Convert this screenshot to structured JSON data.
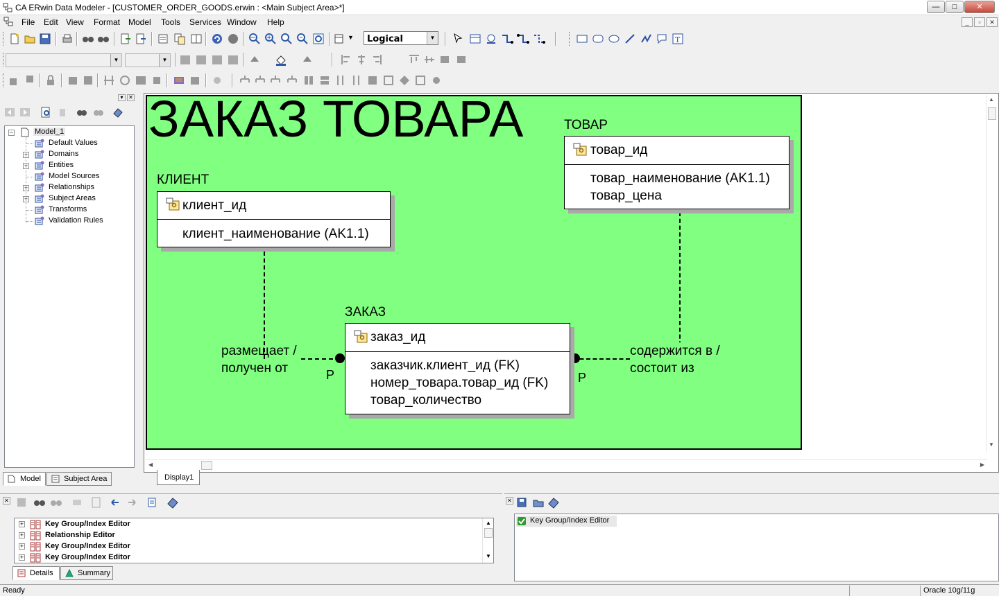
{
  "window": {
    "title": "CA ERwin Data Modeler - [CUSTOMER_ORDER_GOODS.erwin : <Main Subject Area>*]",
    "min_label": "—",
    "max_label": "□",
    "close_label": "✕"
  },
  "menu": {
    "items": [
      "File",
      "Edit",
      "View",
      "Format",
      "Model",
      "Tools",
      "Services",
      "Window",
      "Help"
    ]
  },
  "toolbar": {
    "model_view_value": "Logical"
  },
  "explorer": {
    "root": "Model_1",
    "items": [
      {
        "label": "Default Values",
        "expandable": false,
        "icon": "default-values-icon"
      },
      {
        "label": "Domains",
        "expandable": true,
        "icon": "domains-icon"
      },
      {
        "label": "Entities",
        "expandable": true,
        "icon": "entities-icon"
      },
      {
        "label": "Model Sources",
        "expandable": false,
        "icon": "model-sources-icon"
      },
      {
        "label": "Relationships",
        "expandable": true,
        "icon": "relationships-icon"
      },
      {
        "label": "Subject Areas",
        "expandable": true,
        "icon": "subject-areas-icon"
      },
      {
        "label": "Transforms",
        "expandable": false,
        "icon": "transforms-icon"
      },
      {
        "label": "Validation Rules",
        "expandable": false,
        "icon": "validation-rules-icon"
      }
    ],
    "tabs": [
      "Model",
      "Subject Area"
    ]
  },
  "diagram": {
    "title": "ЗАКАЗ ТОВАРА",
    "subject_area_color": "#80ff80",
    "entities": {
      "client": {
        "name": "КЛИЕНТ",
        "key": "клиент_ид",
        "attributes": [
          "клиент_наименование (AK1.1)"
        ]
      },
      "goods": {
        "name": "ТОВАР",
        "key": "товар_ид",
        "attributes": [
          "товар_наименование (AK1.1)",
          "товар_цена"
        ]
      },
      "order": {
        "name": "ЗАКАЗ",
        "key": "заказ_ид",
        "attributes": [
          "заказчик.клиент_ид (FK)",
          "номер_товара.товар_ид (FK)",
          "товар_количество"
        ]
      }
    },
    "relationships": {
      "client_order": {
        "label_line1": "размещает /",
        "label_line2": "получен от",
        "cardinality": "P"
      },
      "goods_order": {
        "label_line1": "содержится в /",
        "label_line2": "состоит из",
        "cardinality": "P"
      }
    },
    "display_tab": "Display1"
  },
  "action_log": {
    "rows": [
      "Key Group/Index Editor",
      "Relationship Editor",
      "Key Group/Index Editor",
      "Key Group/Index Editor"
    ],
    "tabs": [
      "Details",
      "Summary"
    ]
  },
  "right_pane": {
    "items": [
      "Key Group/Index Editor"
    ]
  },
  "status": {
    "left": "Ready",
    "right": "Oracle 10g/11g"
  }
}
